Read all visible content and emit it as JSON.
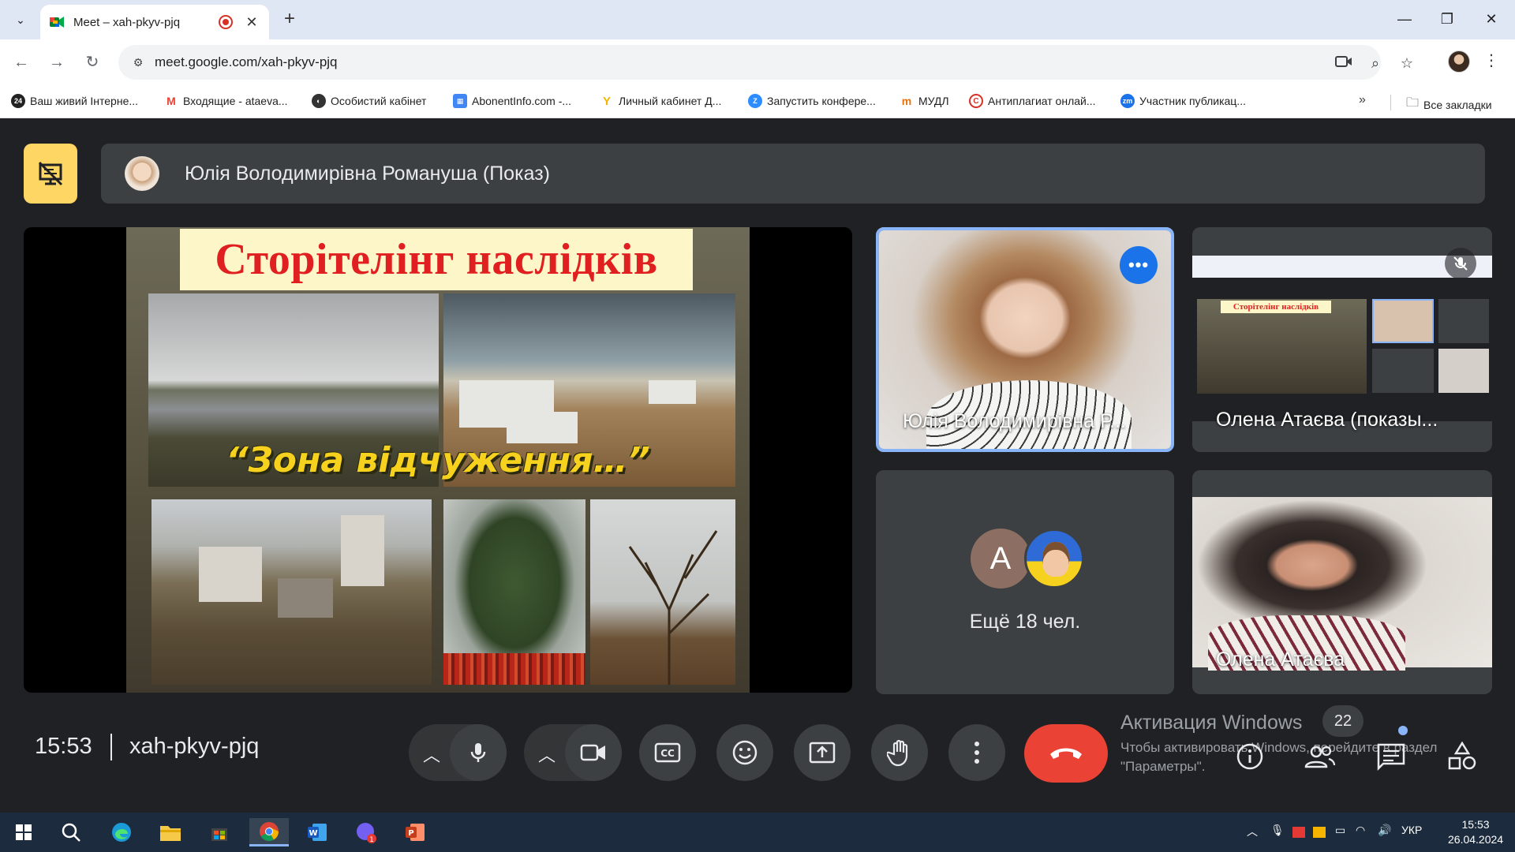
{
  "browser": {
    "tab_title": "Meet – xah-pkyv-pjq",
    "url": "meet.google.com/xah-pkyv-pjq",
    "bookmarks": [
      {
        "label": "Ваш живий Інтерне...",
        "color": "#1f1f1f",
        "glyph": "24"
      },
      {
        "label": "Входящие - ataeva...",
        "color": "#ea4335",
        "glyph": "M"
      },
      {
        "label": "Особистий кабінет",
        "color": "#1f1f1f",
        "glyph": "◐"
      },
      {
        "label": "AbonentInfo.com -...",
        "color": "#f4b400",
        "glyph": "▦"
      },
      {
        "label": "Личный кабинет Д...",
        "color": "#f4b400",
        "glyph": "Y"
      },
      {
        "label": "Запустить конфере...",
        "color": "#2d8cff",
        "glyph": "Z"
      },
      {
        "label": "МУДЛ",
        "color": "#e8710a",
        "glyph": "m"
      },
      {
        "label": "Антиплагиат онлай...",
        "color": "#d93025",
        "glyph": "C"
      },
      {
        "label": "Участник публикац...",
        "color": "#1a73e8",
        "glyph": "zm"
      }
    ],
    "all_bookmarks": "Все закладки"
  },
  "meet": {
    "presenter_label": "Юлія Володимирівна Романуша (Показ)",
    "slide": {
      "title": "Сторітелінг наслідків",
      "caption": "“Зона відчуження…”"
    },
    "tiles": [
      {
        "name": "Юлія Володимирівна Р..."
      },
      {
        "name": "Олена Атаєва (показы..."
      },
      {
        "name": "Олена Атаєва"
      }
    ],
    "others": {
      "avatar_letter": "A",
      "label": "Ещё 18 чел."
    },
    "clock": "15:53",
    "meeting_code": "xah-pkyv-pjq",
    "participant_count": "22",
    "activation": {
      "title": "Активация Windows",
      "subtitle": "Чтобы активировать Windows, перейдите в раздел \"Параметры\"."
    }
  },
  "taskbar": {
    "language": "УКР",
    "time": "15:53",
    "date": "26.04.2024"
  }
}
